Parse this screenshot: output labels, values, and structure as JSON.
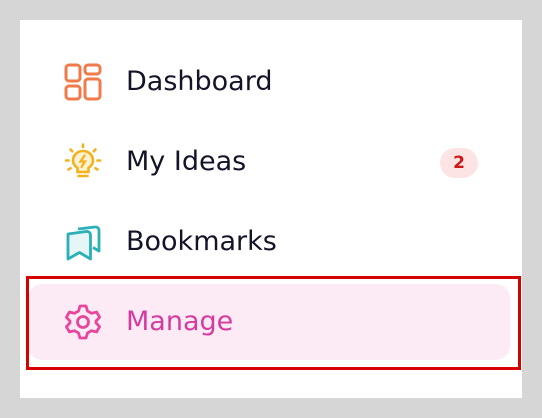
{
  "nav": {
    "items": [
      {
        "label": "Dashboard",
        "icon": "dashboard-icon",
        "icon_color": "#f07a4a"
      },
      {
        "label": "My Ideas",
        "icon": "lightbulb-icon",
        "icon_color": "#f3b21c",
        "badge": "2"
      },
      {
        "label": "Bookmarks",
        "icon": "bookmarks-icon",
        "icon_color": "#2bb0b8"
      },
      {
        "label": "Manage",
        "icon": "gear-icon",
        "icon_color": "#e8459c",
        "selected": true
      }
    ]
  },
  "colors": {
    "selected_background": "#fcebf5",
    "selected_text": "#d63ba0",
    "badge_background": "#fce4e4",
    "badge_text": "#cc1a1a",
    "highlight_outline": "#d60000"
  }
}
